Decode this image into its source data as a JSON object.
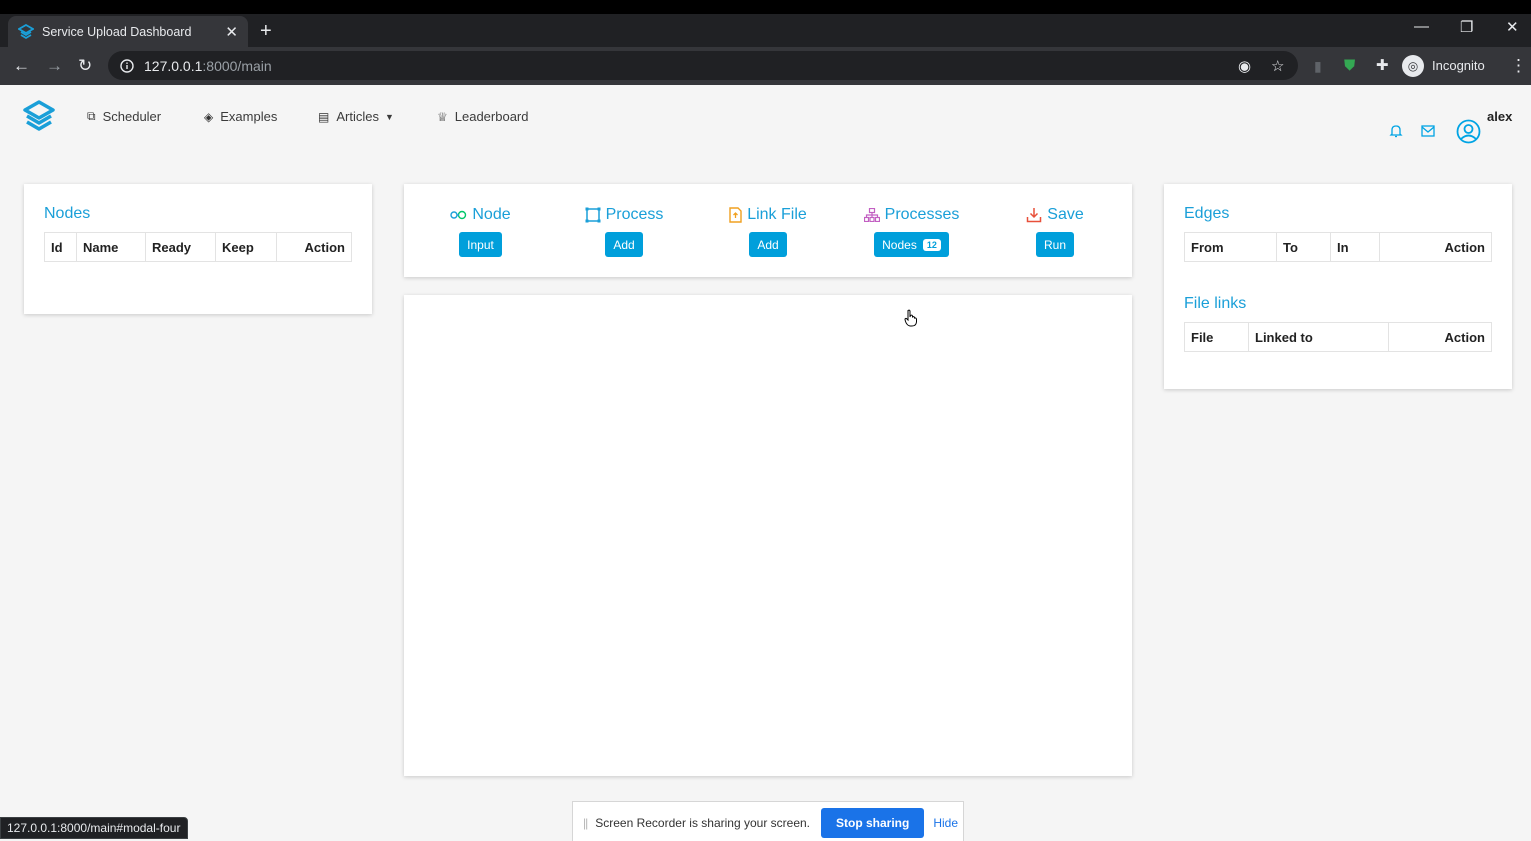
{
  "browser": {
    "tab_title": "Service Upload Dashboard",
    "url_host": "127.0.0.1",
    "url_path": ":8000/main",
    "profile_label": "Incognito",
    "status_url": "127.0.0.1:8000/main#modal-four"
  },
  "nav": {
    "links": [
      {
        "label": "Scheduler",
        "icon": "sitemap-icon"
      },
      {
        "label": "Examples",
        "icon": "layers-icon"
      },
      {
        "label": "Articles",
        "icon": "newspaper-icon"
      },
      {
        "label": "Leaderboard",
        "icon": "trophy-icon"
      }
    ],
    "username": "alex"
  },
  "nodes_panel": {
    "title": "Nodes",
    "columns": [
      "Id",
      "Name",
      "Ready",
      "Keep",
      "Action"
    ]
  },
  "toolbar": {
    "tools": [
      {
        "label": "Node",
        "button": "Input",
        "icon": "node-icon"
      },
      {
        "label": "Process",
        "button": "Add",
        "icon": "square-icon"
      },
      {
        "label": "Link File",
        "button": "Add",
        "icon": "file-icon"
      },
      {
        "label": "Processes",
        "button": "Nodes",
        "badge": "12",
        "icon": "hierarchy-icon"
      },
      {
        "label": "Save",
        "button": "Run",
        "icon": "download-icon"
      }
    ]
  },
  "edges_panel": {
    "title": "Edges",
    "columns": [
      "From",
      "To",
      "In",
      "Action"
    ]
  },
  "file_links_panel": {
    "title": "File links",
    "columns": [
      "File",
      "Linked to",
      "Action"
    ]
  },
  "screen_share": {
    "message": "Screen Recorder is sharing your screen.",
    "stop_label": "Stop sharing",
    "hide_label": "Hide"
  },
  "colors": {
    "accent": "#1a9fd8",
    "button": "#009fdb",
    "share_button": "#1a73e8"
  }
}
